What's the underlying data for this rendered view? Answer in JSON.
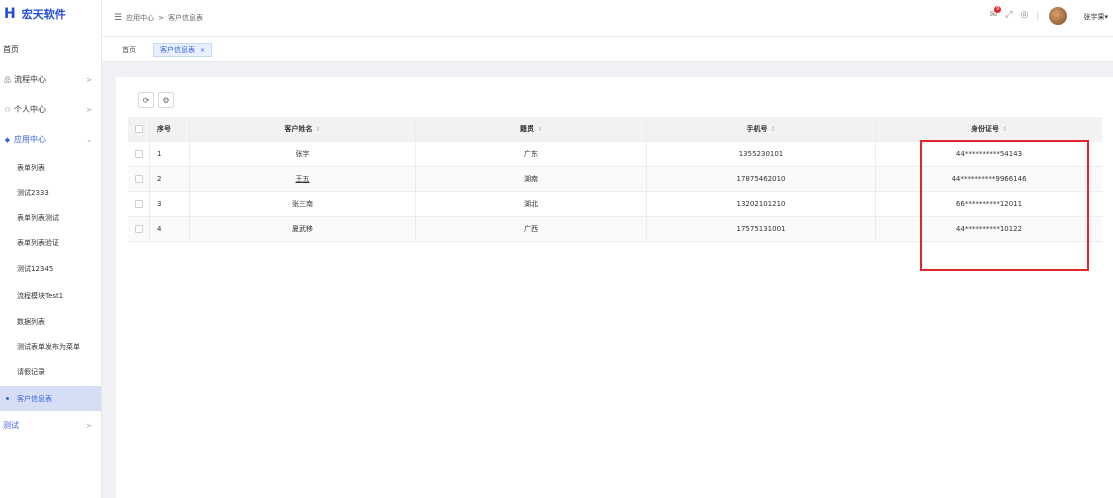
{
  "brand": {
    "logo_mark": "H",
    "name": "宏天软件"
  },
  "sidebar": {
    "home": "首页",
    "groups": [
      {
        "label": "流程中心",
        "icon": "org-chart-icon",
        "arrow": ">"
      },
      {
        "label": "个人中心",
        "icon": "user-icon",
        "arrow": ">"
      },
      {
        "label": "应用中心",
        "icon": "app-icon",
        "arrow": "v"
      }
    ],
    "app_items": [
      "表单列表",
      "测试2333",
      "表单列表测试",
      "表单列表验证",
      "测试12345",
      "流程模块Test1",
      "数据列表",
      "测试表单发布为菜单",
      "请假记录",
      "客户信息表"
    ],
    "last_group": {
      "label": "测试",
      "arrow": ">"
    }
  },
  "header": {
    "breadcrumb_root": "应用中心",
    "breadcrumb_sep": ">",
    "breadcrumb_current": "客户信息表",
    "badge_count": "9",
    "user_name": "张宇果",
    "user_caret": "▾"
  },
  "tabs": {
    "home": "首页",
    "active": "客户信息表",
    "close": "×"
  },
  "table": {
    "columns": [
      "序号",
      "客户姓名",
      "籍贯",
      "手机号",
      "身份证号"
    ],
    "rows": [
      {
        "idx": "1",
        "name": "张宇",
        "province": "广东",
        "phone": "1355230101",
        "id": "44**********54143"
      },
      {
        "idx": "2",
        "name": "王五",
        "province": "湖南",
        "phone": "17875462010",
        "id": "44**********9966146"
      },
      {
        "idx": "3",
        "name": "张三南",
        "province": "湖北",
        "phone": "13202101210",
        "id": "66**********12011"
      },
      {
        "idx": "4",
        "name": "夏武移",
        "province": "广西",
        "phone": "17575131001",
        "id": "44**********10122"
      }
    ]
  },
  "colors": {
    "accent": "#3a63e0",
    "highlight_box": "#e0262c"
  }
}
